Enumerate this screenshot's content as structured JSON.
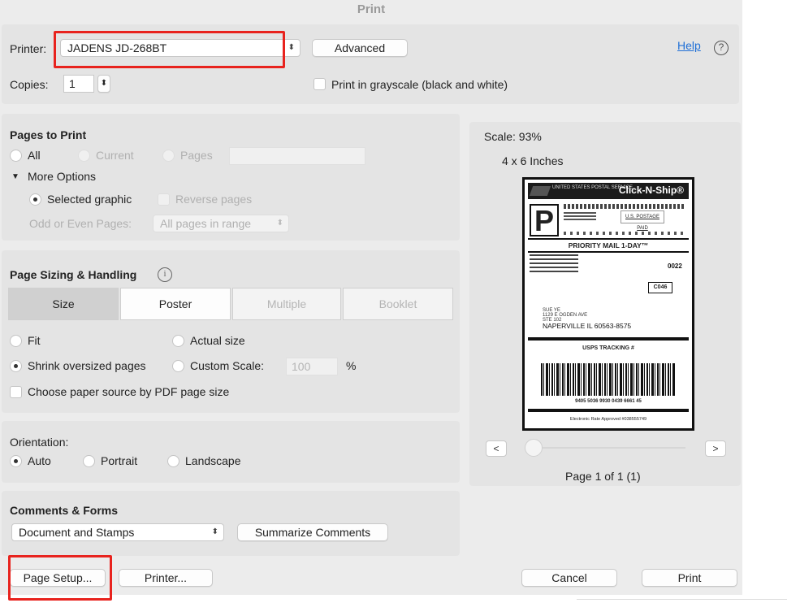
{
  "window": {
    "title": "Print"
  },
  "printer": {
    "label": "Printer:",
    "value": "JADENS JD-268BT",
    "advanced": "Advanced",
    "help": "Help",
    "help_icon": "?"
  },
  "copies": {
    "label": "Copies:",
    "value": "1",
    "grayscale_label": "Print in grayscale (black and white)"
  },
  "pages_to_print": {
    "heading": "Pages to Print",
    "all": "All",
    "current": "Current",
    "pages": "Pages",
    "more_options": "More Options",
    "selected_graphic": "Selected graphic",
    "reverse_pages": "Reverse pages",
    "odd_even_label": "Odd or Even Pages:",
    "odd_even_value": "All pages in range"
  },
  "page_sizing": {
    "heading": "Page Sizing & Handling",
    "info_icon": "i",
    "tabs": [
      "Size",
      "Poster",
      "Multiple",
      "Booklet"
    ],
    "fit": "Fit",
    "actual_size": "Actual size",
    "shrink": "Shrink oversized pages",
    "custom_scale": "Custom Scale:",
    "custom_scale_value": "100",
    "percent": "%",
    "paper_source": "Choose paper source by PDF page size"
  },
  "orientation": {
    "heading": "Orientation:",
    "auto": "Auto",
    "portrait": "Portrait",
    "landscape": "Landscape"
  },
  "comments_forms": {
    "heading": "Comments & Forms",
    "value": "Document and Stamps",
    "summarize": "Summarize Comments"
  },
  "preview": {
    "scale": "Scale: 93%",
    "size": "4 x 6 Inches",
    "page_info": "Page 1 of 1 (1)",
    "prev": "<",
    "next": ">",
    "label": {
      "brand": "Click-N-Ship®",
      "usps": "UNITED STATES POSTAL SERVICE",
      "letter": "P",
      "us_postage": "U.S. POSTAGE PAID",
      "service": "PRIORITY MAIL 1-DAY™",
      "code_0022": "0022",
      "code_c046": "C046",
      "ship_to_1": "SUE YE",
      "ship_to_2": "1129 E OGDEN AVE",
      "ship_to_3": "STE 102",
      "ship_to_4": "NAPERVILLE IL 60563-8575",
      "tracking_title": "USPS TRACKING #",
      "tracking_number": "9405 5036 9930 0439 6661 45",
      "footer": "Electronic Rate Approved #038555749"
    }
  },
  "footer_buttons": {
    "page_setup": "Page Setup...",
    "printer": "Printer...",
    "cancel": "Cancel",
    "print": "Print"
  }
}
